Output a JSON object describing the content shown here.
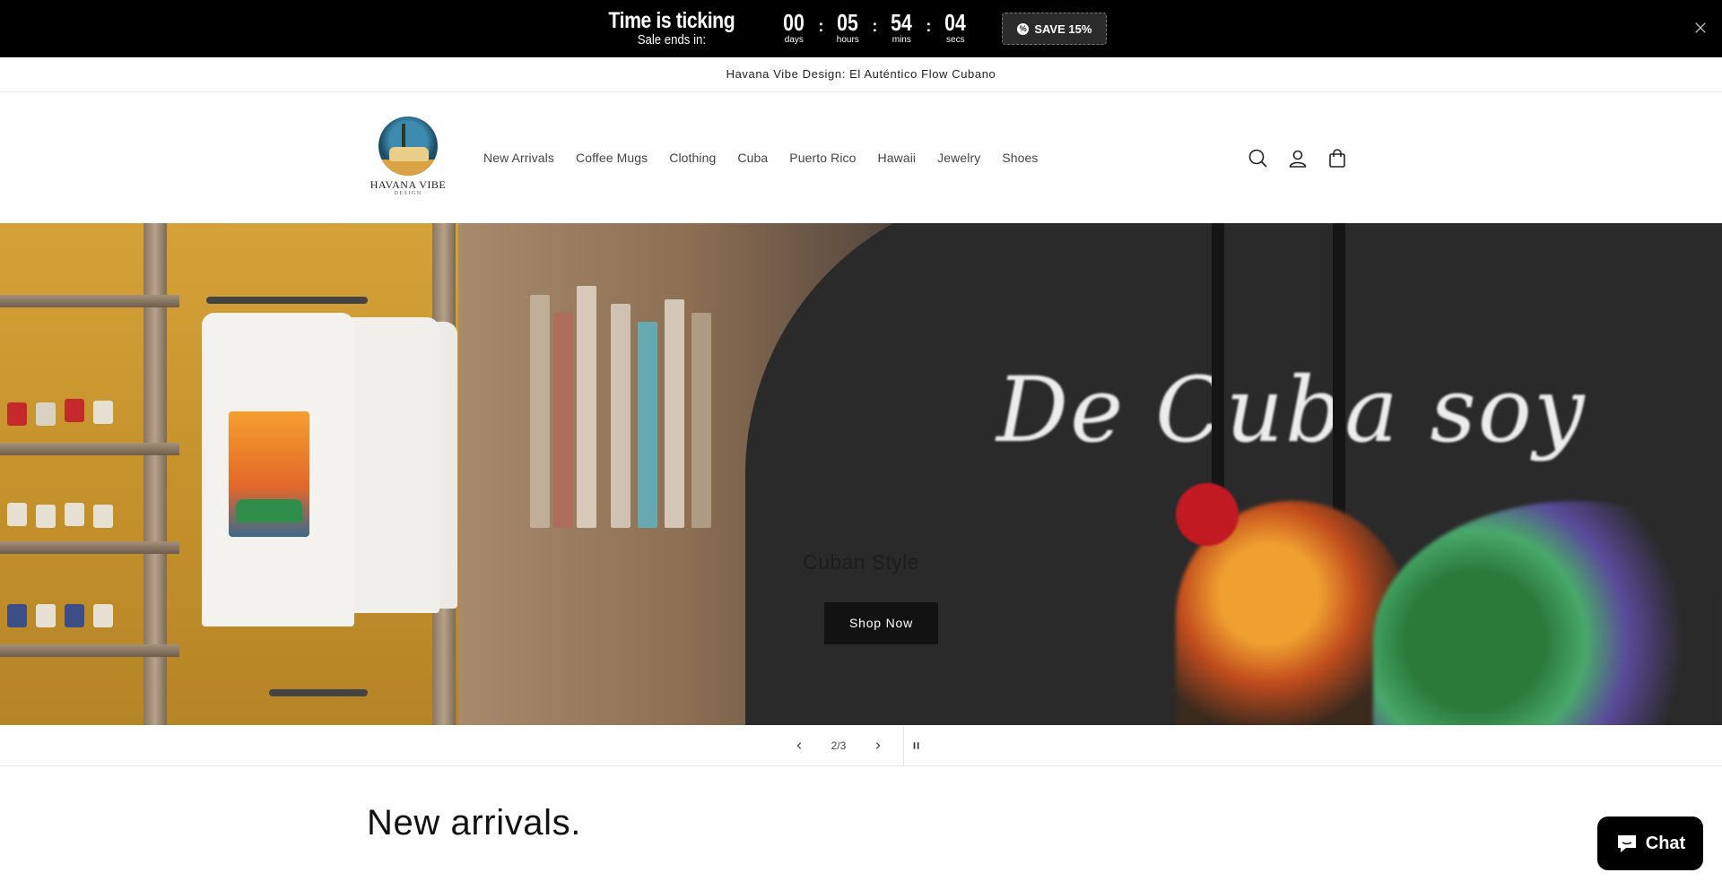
{
  "countdown": {
    "title": "Time is ticking",
    "subtitle": "Sale ends in:",
    "units": [
      {
        "value": "00",
        "label": "days"
      },
      {
        "value": "05",
        "label": "hours"
      },
      {
        "value": "54",
        "label": "mins"
      },
      {
        "value": "04",
        "label": "secs"
      }
    ],
    "separator": ":",
    "save_label": "SAVE 15%",
    "close_icon": "close-icon"
  },
  "announcement": "Havana Vibe Design: El Auténtico Flow Cubano",
  "header": {
    "logo_text": "HAVANA VIBE",
    "logo_sub": "DESIGN",
    "nav": [
      "New Arrivals",
      "Coffee Mugs",
      "Clothing",
      "Cuba",
      "Puerto Rico",
      "Hawaii",
      "Jewelry",
      "Shoes"
    ],
    "icons": [
      "search-icon",
      "account-icon",
      "cart-icon"
    ]
  },
  "hero": {
    "image_text": "De Cuba soy",
    "caption": "Cuban Style",
    "button_label": "Shop Now"
  },
  "slider": {
    "counter": "2/3",
    "prev_icon": "chevron-left-icon",
    "next_icon": "chevron-right-icon",
    "pause_icon": "pause-icon"
  },
  "section": {
    "title": "New arrivals."
  },
  "chat": {
    "label": "Chat"
  }
}
